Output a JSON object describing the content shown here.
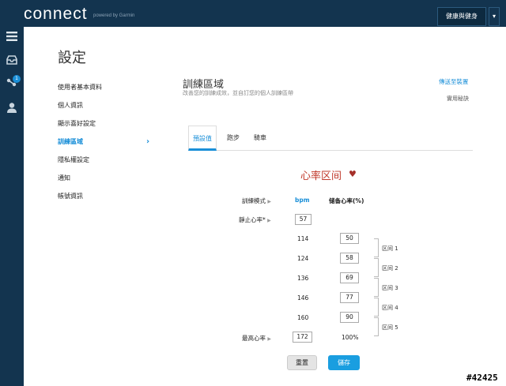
{
  "header": {
    "logo": "connect",
    "powered": "powered by Garmin",
    "menu_button": "健康與健身",
    "caret": "▾"
  },
  "leftbar": {
    "badge": "1"
  },
  "page_title": "設定",
  "sidebar": {
    "items": [
      {
        "label": "使用者基本資料"
      },
      {
        "label": "個人資訊"
      },
      {
        "label": "顯示喜好設定"
      },
      {
        "label": "訓練區域"
      },
      {
        "label": "隱私權設定"
      },
      {
        "label": "通知"
      },
      {
        "label": "帳號資訊"
      }
    ]
  },
  "section": {
    "title": "訓練區域",
    "subtitle": "改善您的訓練成效，並自訂您的個人訓練區帶",
    "send_link": "傳送至裝置",
    "help": "實用秘訣"
  },
  "tabs": [
    {
      "label": "預設值"
    },
    {
      "label": "跑步"
    },
    {
      "label": "騎車"
    }
  ],
  "hr": {
    "title": "心率区间",
    "mode_label": "訓練模式",
    "col_bpm": "bpm",
    "col_reserve": "储备心率(%)",
    "resting_label": "靜止心率*",
    "resting_value": "57",
    "max_label": "最高心率",
    "max_value": "172",
    "max_pct": "100%",
    "rows": [
      {
        "bpm": "114",
        "pct": "50"
      },
      {
        "bpm": "124",
        "pct": "58"
      },
      {
        "bpm": "136",
        "pct": "69"
      },
      {
        "bpm": "146",
        "pct": "77"
      },
      {
        "bpm": "160",
        "pct": "90"
      }
    ],
    "zones": [
      "区间 1",
      "区间 2",
      "区间 3",
      "区间 4",
      "区间 5"
    ]
  },
  "buttons": {
    "reset": "重置",
    "save": "儲存"
  },
  "watermark": "#42425"
}
